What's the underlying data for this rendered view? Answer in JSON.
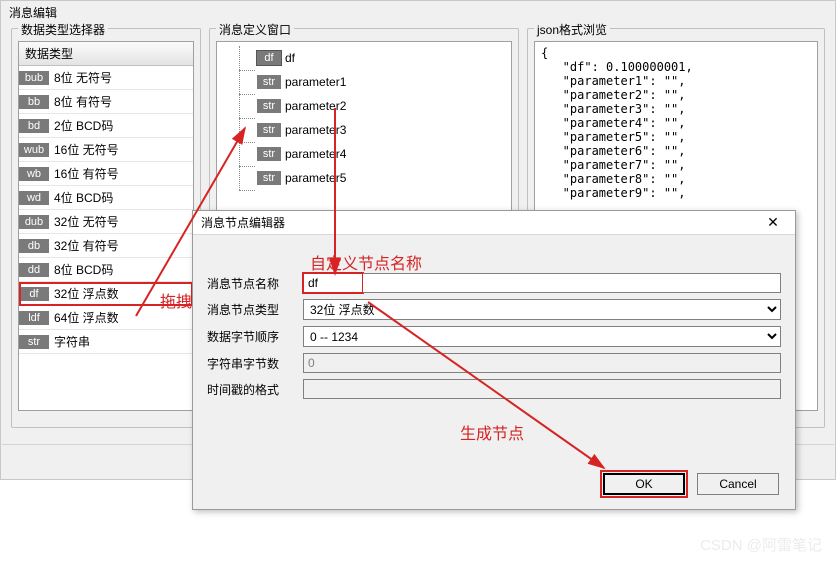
{
  "window_title": "消息编辑",
  "groups": {
    "types": "数据类型选择器",
    "tree": "消息定义窗口",
    "json": "json格式浏览"
  },
  "type_header": "数据类型",
  "types": [
    {
      "badge": "bub",
      "label": "8位 无符号"
    },
    {
      "badge": "bb",
      "label": "8位 有符号"
    },
    {
      "badge": "bd",
      "label": "2位 BCD码"
    },
    {
      "badge": "wub",
      "label": "16位 无符号"
    },
    {
      "badge": "wb",
      "label": "16位 有符号"
    },
    {
      "badge": "wd",
      "label": "4位 BCD码"
    },
    {
      "badge": "dub",
      "label": "32位 无符号"
    },
    {
      "badge": "db",
      "label": "32位 有符号"
    },
    {
      "badge": "dd",
      "label": "8位 BCD码"
    },
    {
      "badge": "df",
      "label": "32位 浮点数"
    },
    {
      "badge": "ldf",
      "label": "64位 浮点数"
    },
    {
      "badge": "str",
      "label": "字符串"
    }
  ],
  "selected_type_index": 9,
  "tree_items": [
    {
      "badge": "df",
      "label": "df"
    },
    {
      "badge": "str",
      "label": "parameter1"
    },
    {
      "badge": "str",
      "label": "parameter2"
    },
    {
      "badge": "str",
      "label": "parameter3"
    },
    {
      "badge": "str",
      "label": "parameter4"
    },
    {
      "badge": "str",
      "label": "parameter5"
    }
  ],
  "json_preview": "{\n   \"df\": 0.100000001,\n   \"parameter1\": \"\",\n   \"parameter2\": \"\",\n   \"parameter3\": \"\",\n   \"parameter4\": \"\",\n   \"parameter5\": \"\",\n   \"parameter6\": \"\",\n   \"parameter7\": \"\",\n   \"parameter8\": \"\",\n   \"parameter9\": \"\",",
  "dialog": {
    "title": "消息节点编辑器",
    "fields": {
      "name_label": "消息节点名称",
      "name_value": "df",
      "type_label": "消息节点类型",
      "type_value": "32位 浮点数",
      "order_label": "数据字节顺序",
      "order_value": "0 -- 1234",
      "strlen_label": "字符串字节数",
      "strlen_value": "0",
      "ts_label": "时间戳的格式",
      "ts_value": ""
    },
    "ok": "OK",
    "cancel": "Cancel"
  },
  "annotations": {
    "drag": "拖拽",
    "custom_name": "自定义节点名称",
    "generate": "生成节点"
  },
  "watermark": "CSDN @阿雷笔记"
}
